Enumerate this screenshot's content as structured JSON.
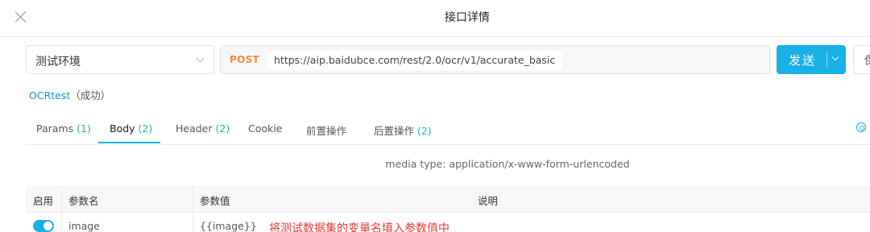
{
  "window": {
    "title": "接口详情"
  },
  "request": {
    "environment": "测试环境",
    "method": "POST",
    "url": "https://aip.baidubce.com/rest/2.0/ocr/v1/accurate_basic",
    "send_label": "发送",
    "save_label": "保"
  },
  "case": {
    "name": "OCRtest",
    "status": "（成功）"
  },
  "tabs": [
    {
      "label": "Params",
      "count": "(1)"
    },
    {
      "label": "Body",
      "count": "(2)"
    },
    {
      "label": "Header",
      "count": "(2)"
    },
    {
      "label": "Cookie",
      "count": ""
    },
    {
      "label": "前置操作",
      "count": ""
    },
    {
      "label": "后置操作",
      "count": "(2)"
    }
  ],
  "active_tab": "Body",
  "body": {
    "media_type": "media type: application/x-www-form-urlencoded",
    "columns": [
      "启用",
      "参数名",
      "参数值",
      "说明"
    ],
    "rows": [
      {
        "enabled": true,
        "name": "image",
        "value": "{{image}}",
        "description": ""
      }
    ]
  },
  "annotation": "将测试数据集的变量名填入参数值中",
  "colors": {
    "accent": "#19b2e6",
    "method_post": "#f0883a",
    "count": "#26b6a6",
    "annotation": "#e53935",
    "link": "#1890d4"
  }
}
